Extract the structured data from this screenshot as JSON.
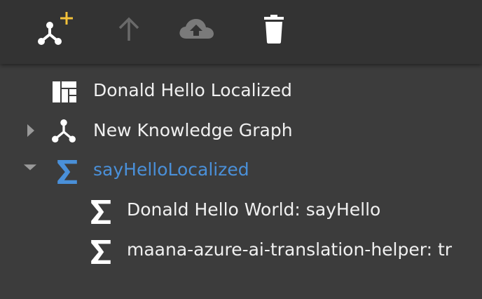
{
  "toolbar": {
    "buttons": [
      {
        "name": "add-knowledge-graph",
        "icon": "graph-add-icon"
      },
      {
        "name": "move-up",
        "icon": "arrow-up-icon"
      },
      {
        "name": "upload",
        "icon": "cloud-upload-icon"
      },
      {
        "name": "delete",
        "icon": "trash-icon"
      }
    ],
    "accent_color": "#f3c13a"
  },
  "tree": {
    "items": [
      {
        "label": "Donald Hello Localized",
        "icon": "workspace-icon",
        "expander": "none",
        "selected": false
      },
      {
        "label": "New Knowledge Graph",
        "icon": "knowledge-graph-icon",
        "expander": "collapsed",
        "selected": false
      },
      {
        "label": "sayHelloLocalized",
        "icon": "function-sigma-icon",
        "expander": "expanded",
        "selected": true
      },
      {
        "label": "Donald Hello World: sayHello",
        "icon": "function-sigma-icon",
        "expander": "none",
        "selected": false
      },
      {
        "label": "maana-azure-ai-translation-helper: tr",
        "icon": "function-sigma-icon",
        "expander": "none",
        "selected": false
      }
    ],
    "selected_color": "#4a90d9",
    "text_color": "#f0f0f0"
  }
}
